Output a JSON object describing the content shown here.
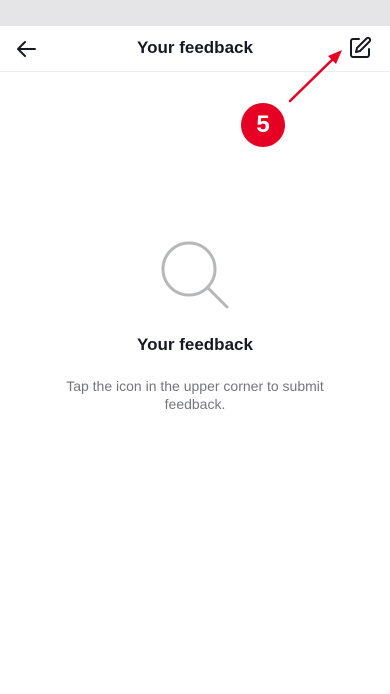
{
  "header": {
    "title": "Your feedback"
  },
  "annotation": {
    "badge_number": "5",
    "color": "#e60023"
  },
  "empty_state": {
    "title": "Your feedback",
    "description": "Tap the icon in the upper corner to submit feedback."
  },
  "icons": {
    "back": "arrow-left-icon",
    "edit": "edit-icon",
    "empty": "search-icon"
  }
}
